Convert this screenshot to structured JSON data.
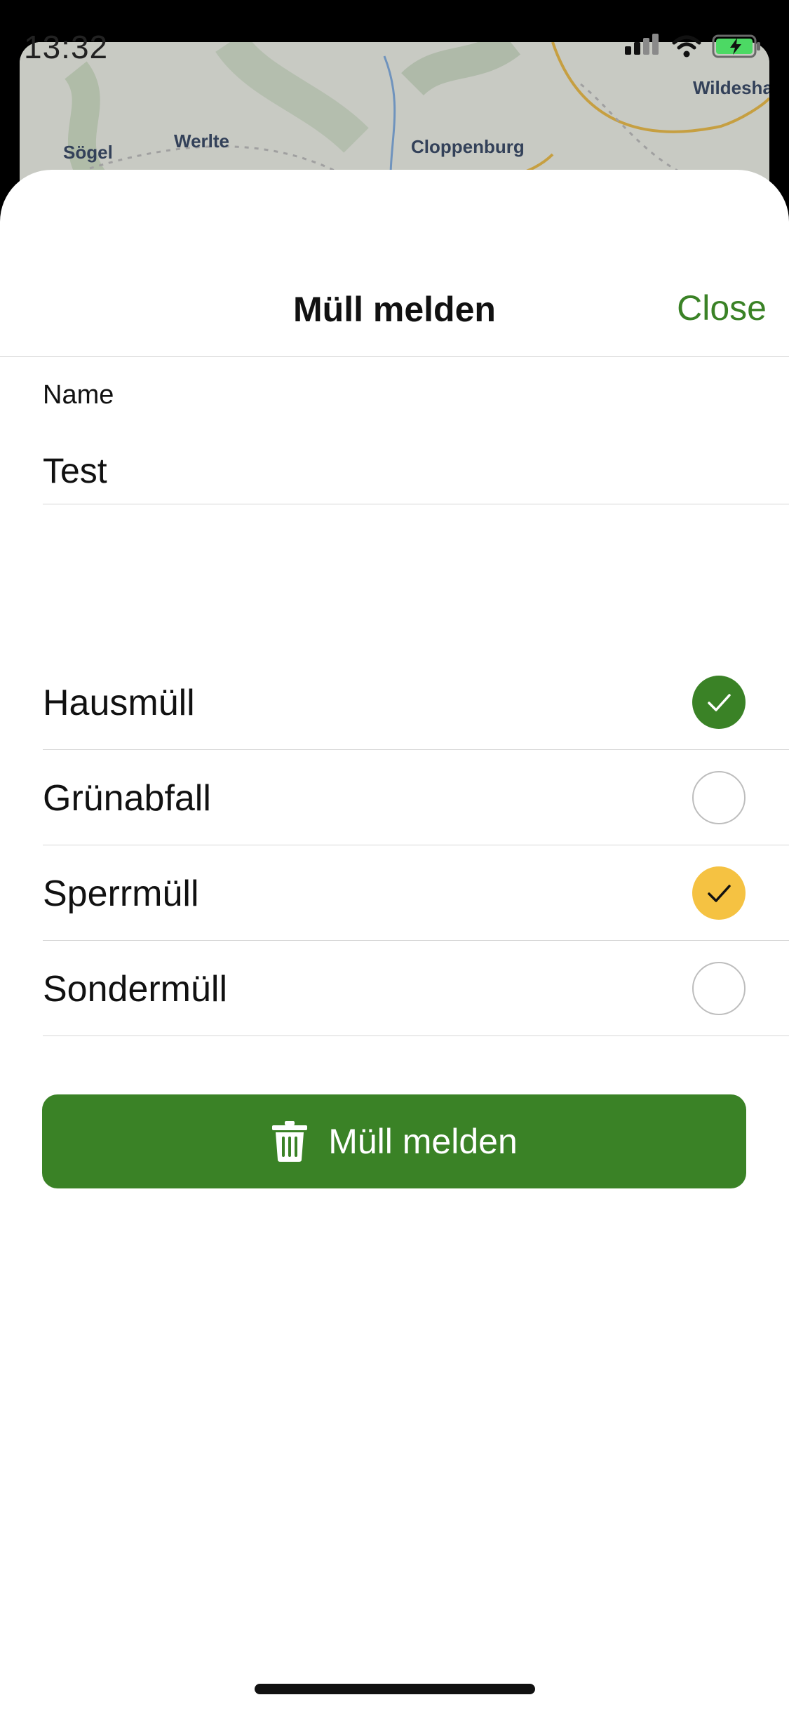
{
  "status": {
    "time": "13:32"
  },
  "map": {
    "labels": [
      "Sögel",
      "Werlte",
      "Cloppenburg",
      "Wildesha"
    ]
  },
  "sheet": {
    "title": "Müll melden",
    "close_label": "Close",
    "name_field": {
      "label": "Name",
      "value": "Test"
    },
    "options": [
      {
        "label": "Hausmüll",
        "checked": true,
        "color": "#3a8226"
      },
      {
        "label": "Grünabfall",
        "checked": false,
        "color": ""
      },
      {
        "label": "Sperrmüll",
        "checked": true,
        "color": "#f5c242"
      },
      {
        "label": "Sondermüll",
        "checked": false,
        "color": ""
      }
    ],
    "submit": {
      "label": "Müll melden",
      "icon": "trash-icon"
    }
  },
  "colors": {
    "accent": "#3a8226",
    "yellow": "#f5c242"
  }
}
